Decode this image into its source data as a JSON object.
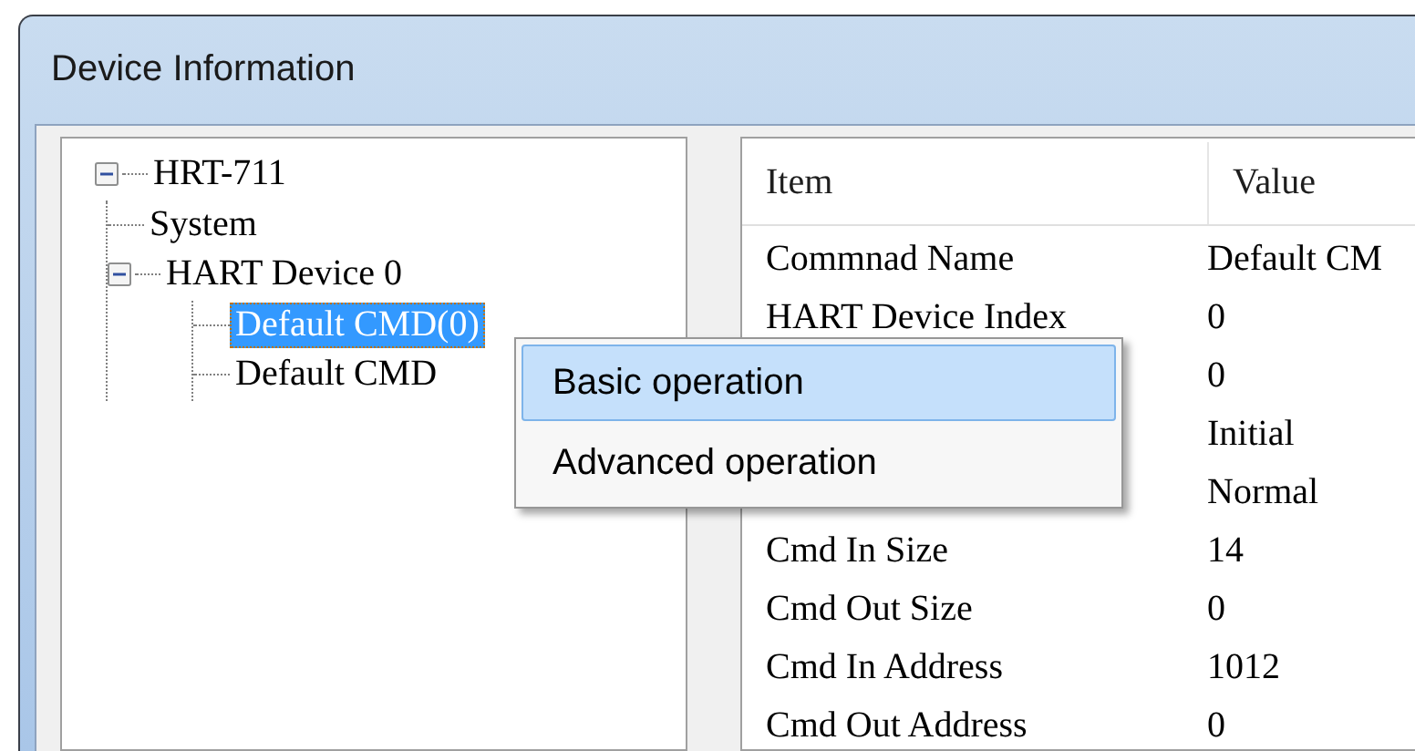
{
  "window": {
    "title": "Device Information"
  },
  "tree": [
    {
      "label": "HRT-711",
      "expanded": true,
      "selected": false,
      "children": [
        {
          "label": "System",
          "selected": false
        },
        {
          "label": "HART Device 0",
          "expanded": true,
          "selected": false,
          "children": [
            {
              "label": "Default CMD(0)",
              "selected": true
            },
            {
              "label": "Default CMD",
              "selected": false
            }
          ]
        }
      ]
    }
  ],
  "table": {
    "columns": [
      "Item",
      "Value"
    ],
    "rows": [
      {
        "item": "Commnad Name",
        "value": "Default CM"
      },
      {
        "item": "HART Device Index",
        "value": "0"
      },
      {
        "value": "0"
      },
      {
        "value": "Initial"
      },
      {
        "value": "Normal"
      },
      {
        "item": "Cmd In Size",
        "value": "14"
      },
      {
        "item": "Cmd Out Size",
        "value": "0"
      },
      {
        "item": "Cmd In Address",
        "value": "1012"
      },
      {
        "item": "Cmd Out Address",
        "value": "0"
      }
    ]
  },
  "context_menu": {
    "items": [
      {
        "label": "Basic operation",
        "selected": true
      },
      {
        "label": "Advanced operation",
        "selected": false
      }
    ]
  }
}
